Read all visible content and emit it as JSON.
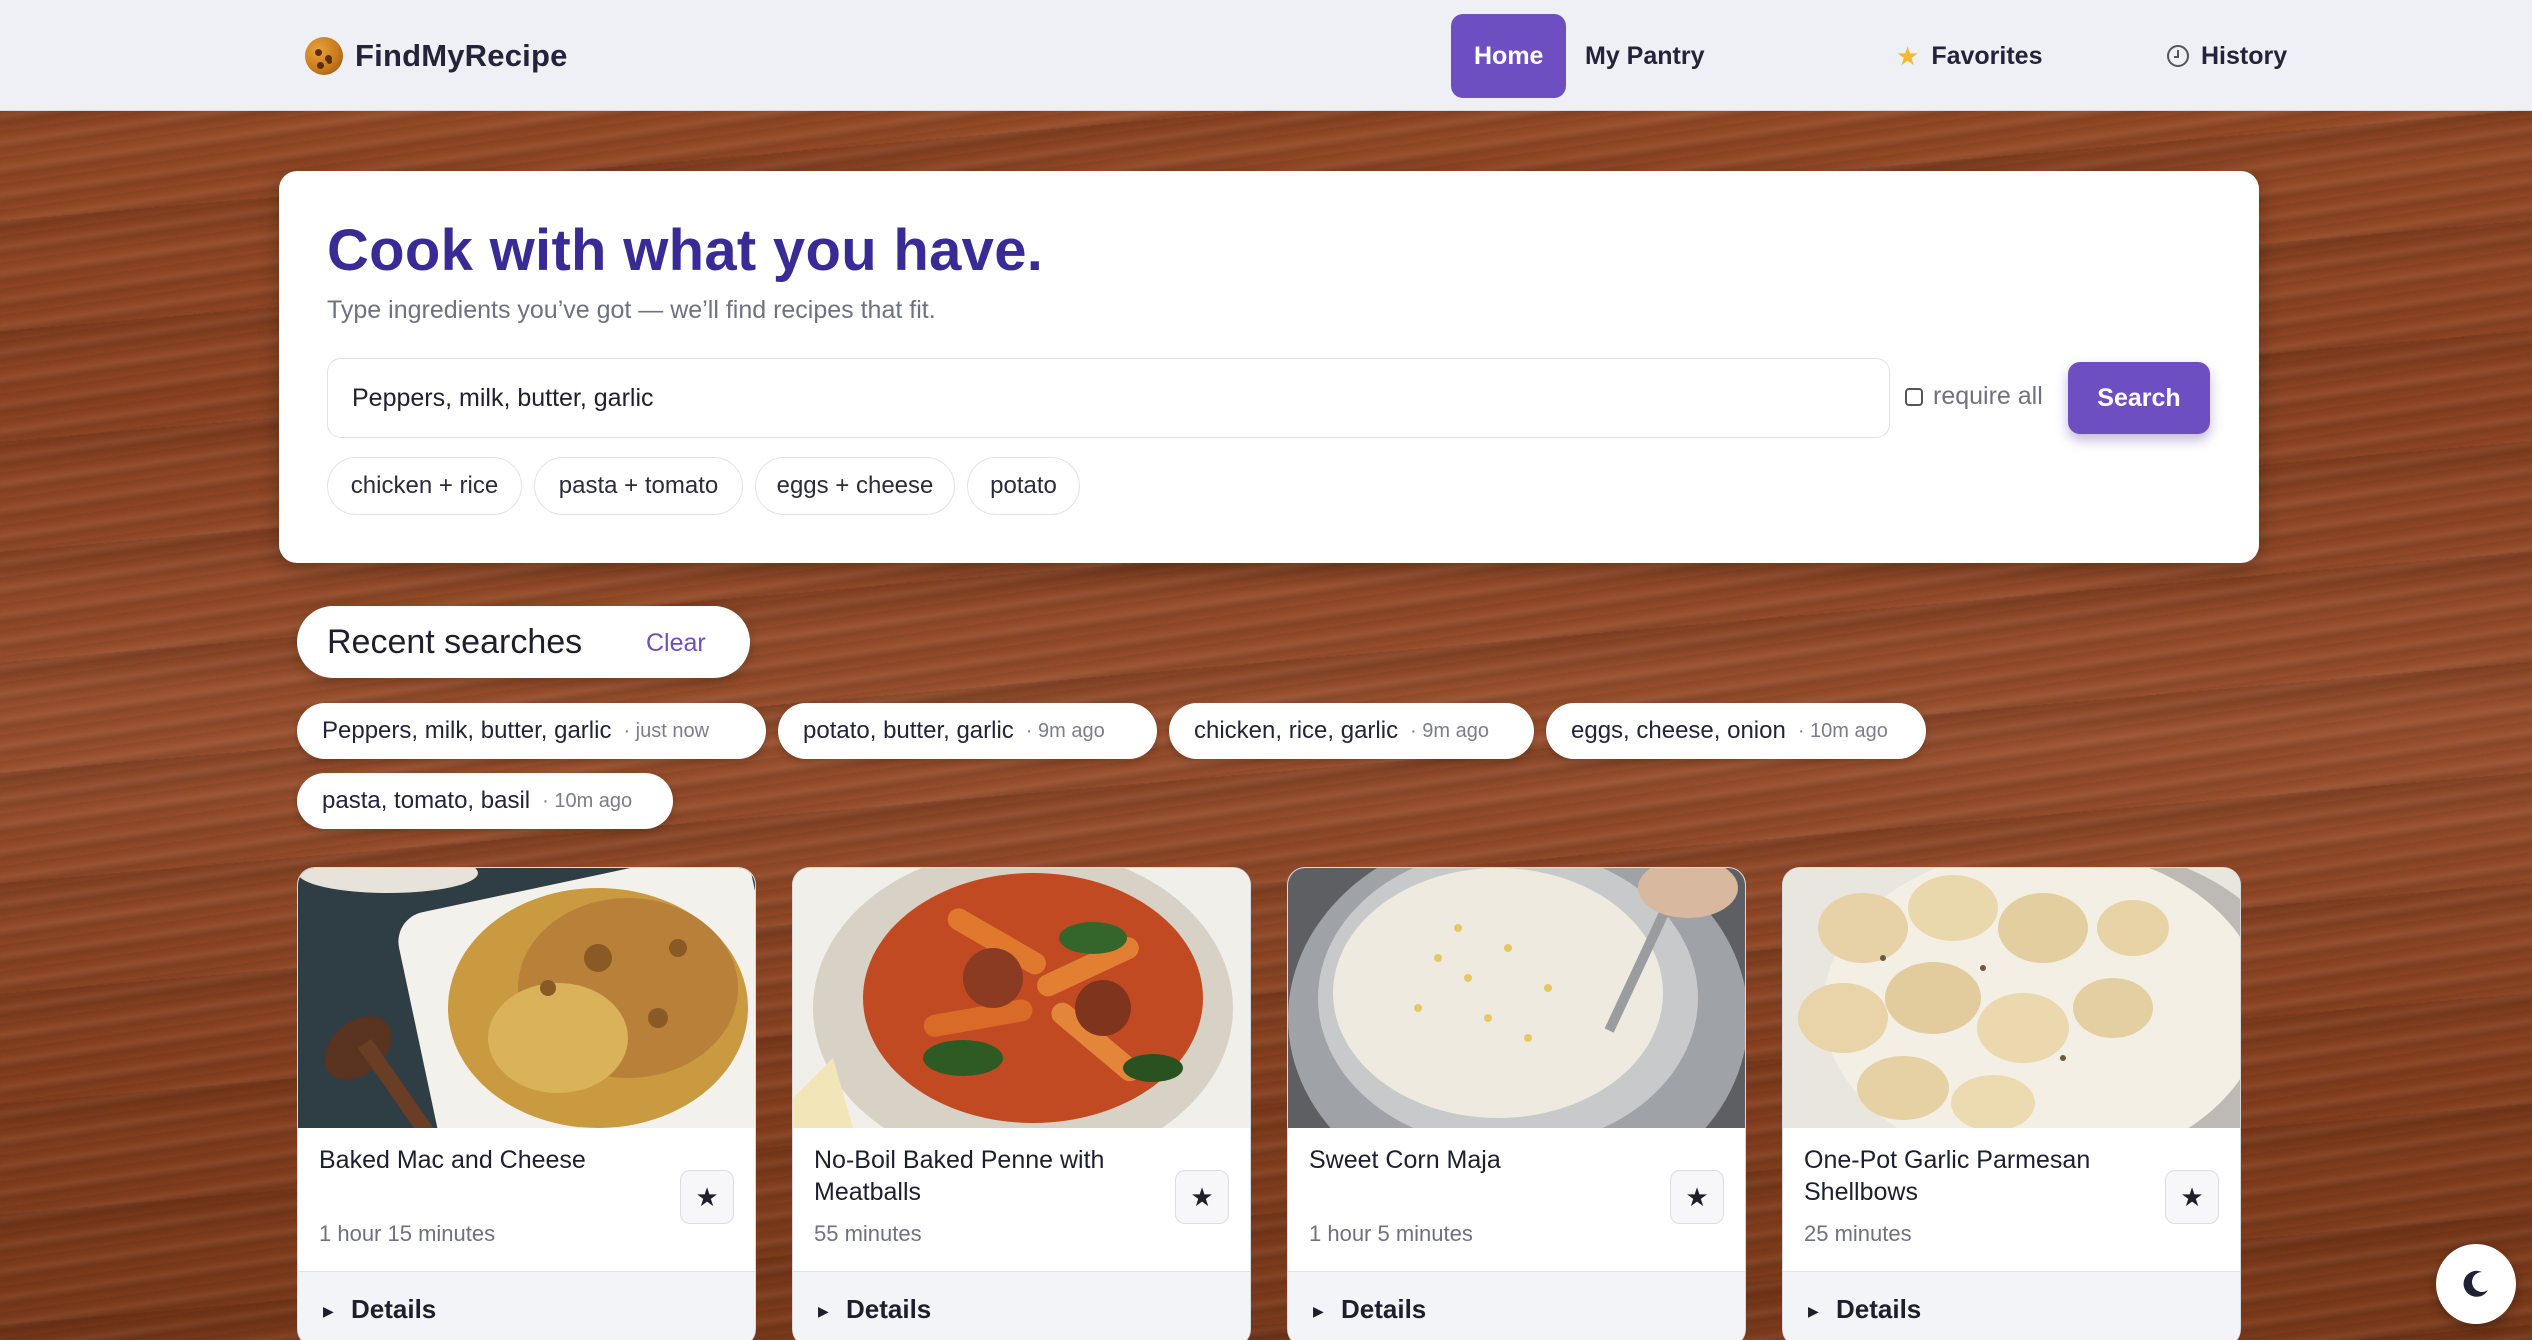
{
  "app": {
    "brand": "FindMyRecipe",
    "logo_icon": "cookie-icon"
  },
  "nav": {
    "items": [
      {
        "label": "Home",
        "active": true
      },
      {
        "label": "My Pantry",
        "active": false
      },
      {
        "label": "Favorites",
        "icon": "star-icon",
        "active": false
      },
      {
        "label": "History",
        "icon": "clock-icon",
        "active": false
      }
    ]
  },
  "hero": {
    "title": "Cook with what you have.",
    "subtitle": "Type ingredients you’ve got — we’ll find recipes that fit.",
    "search_value": "Peppers, milk, butter, garlic",
    "require_all_label": "require all",
    "search_button": "Search",
    "suggestions": [
      "chicken + rice",
      "pasta + tomato",
      "eggs + cheese",
      "potato"
    ]
  },
  "recent": {
    "title": "Recent searches",
    "clear_label": "Clear",
    "items": [
      {
        "text": "Peppers, milk, butter, garlic",
        "time": "· just now"
      },
      {
        "text": "potato, butter, garlic",
        "time": "· 9m ago"
      },
      {
        "text": "chicken, rice, garlic",
        "time": "· 9m ago"
      },
      {
        "text": "eggs, cheese, onion",
        "time": "· 10m ago"
      },
      {
        "text": "pasta, tomato, basil",
        "time": "· 10m ago"
      }
    ]
  },
  "recipes": [
    {
      "title": "Baked Mac and Cheese",
      "time": "1 hour 15 minutes",
      "details": "Details"
    },
    {
      "title": "No-Boil Baked Penne with Meatballs",
      "time": "55 minutes",
      "details": "Details"
    },
    {
      "title": "Sweet Corn Maja",
      "time": "1 hour 5 minutes",
      "details": "Details"
    },
    {
      "title": "One-Pot Garlic Parmesan Shellbows",
      "time": "25 minutes",
      "details": "Details"
    }
  ],
  "colors": {
    "accent": "#6d4fc2",
    "title": "#3a2a96"
  }
}
